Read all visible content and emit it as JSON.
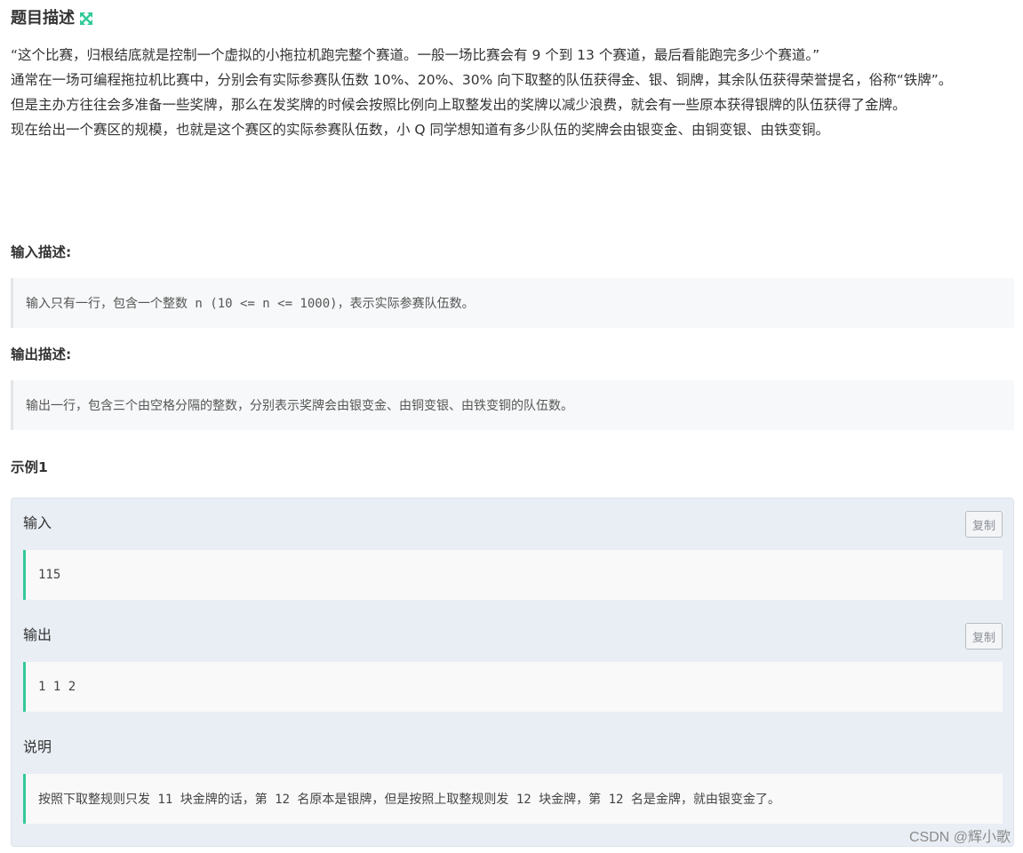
{
  "problem": {
    "title": "题目描述",
    "description": [
      "“这个比赛，归根结底就是控制一个虚拟的小拖拉机跑完整个赛道。一般一场比赛会有 9 个到 13 个赛道，最后看能跑完多少个赛道。”",
      "通常在一场可编程拖拉机比赛中，分别会有实际参赛队伍数 10%、20%、30% 向下取整的队伍获得金、银、铜牌，其余队伍获得荣誉提名，俗称“铁牌”。",
      "但是主办方往往会多准备一些奖牌，那么在发奖牌的时候会按照比例向上取整发出的奖牌以减少浪费，就会有一些原本获得银牌的队伍获得了金牌。",
      "现在给出一个赛区的规模，也就是这个赛区的实际参赛队伍数，小 Q 同学想知道有多少队伍的奖牌会由银变金、由铜变银、由铁变铜。"
    ]
  },
  "input_section": {
    "heading": "输入描述:",
    "text": "输入只有一行，包含一个整数 n (10 <= n <= 1000)，表示实际参赛队伍数。"
  },
  "output_section": {
    "heading": "输出描述:",
    "text": "输出一行，包含三个由空格分隔的整数，分别表示奖牌会由银变金、由铜变银、由铁变铜的队伍数。"
  },
  "example": {
    "heading": "示例1",
    "input_label": "输入",
    "input_value": "115",
    "output_label": "输出",
    "output_value": "1 1 2",
    "explain_label": "说明",
    "explain_text": "按照下取整规则只发 11 块金牌的话，第 12 名原本是银牌，但是按照上取整规则发 12 块金牌，第 12 名是金牌，就由银变金了。",
    "copy_label": "复制"
  },
  "watermark": "CSDN @辉小歌",
  "colors": {
    "accent": "#32ca99",
    "quote_bg": "#f7f8f9",
    "example_bg": "#e9eef5"
  },
  "icons": {
    "expand": "expand-arrows-icon"
  }
}
